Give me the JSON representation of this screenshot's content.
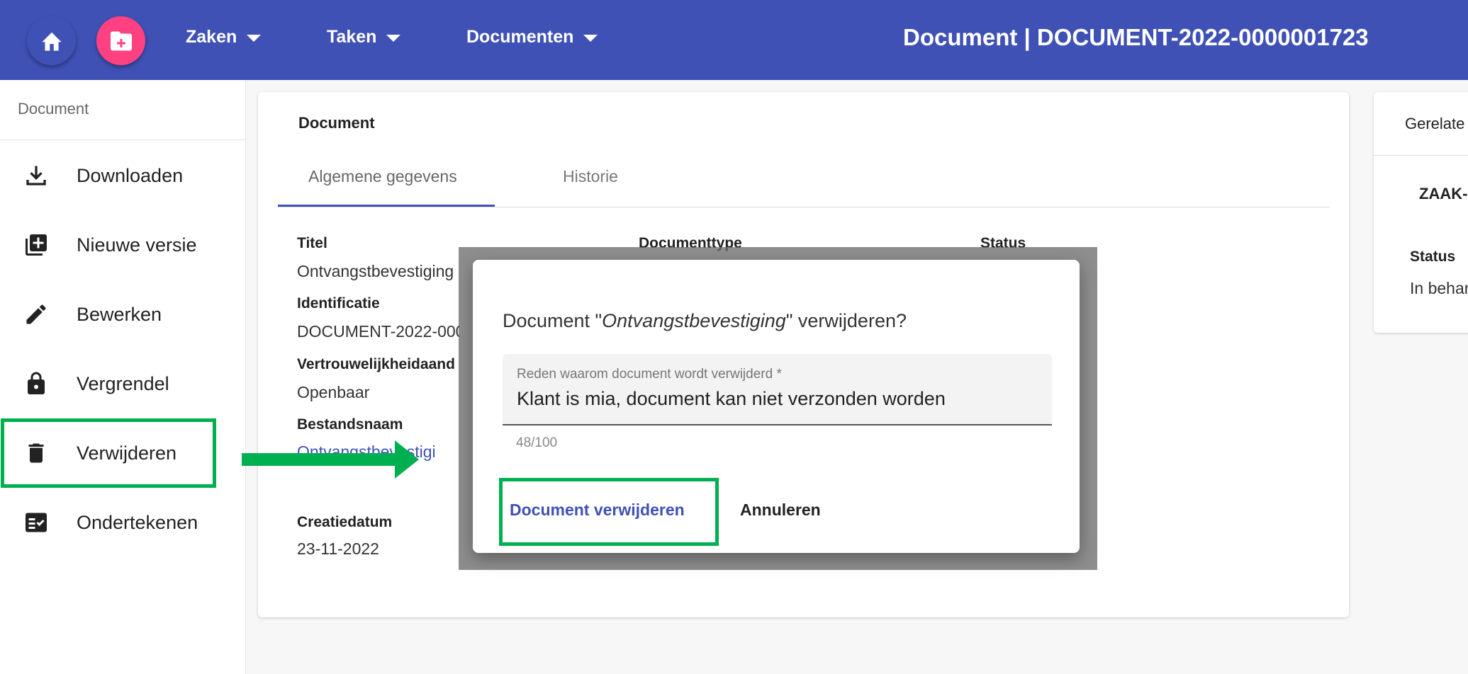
{
  "header": {
    "home_icon": "home-icon",
    "new_icon": "folder-plus-icon",
    "nav": [
      "Zaken",
      "Taken",
      "Documenten"
    ],
    "title": "Document | DOCUMENT-2022-0000001723",
    "colors": {
      "primary": "#3f51b5",
      "accent": "#ff4081"
    }
  },
  "sidebar": {
    "header": "Document",
    "items": [
      {
        "label": "Downloaden",
        "icon": "download-icon"
      },
      {
        "label": "Nieuwe versie",
        "icon": "new-version-icon"
      },
      {
        "label": "Bewerken",
        "icon": "pencil-icon"
      },
      {
        "label": "Vergrendel",
        "icon": "lock-icon"
      },
      {
        "label": "Verwijderen",
        "icon": "trash-icon"
      },
      {
        "label": "Ondertekenen",
        "icon": "sign-icon"
      }
    ]
  },
  "main": {
    "card_title": "Document",
    "tabs": [
      "Algemene gegevens",
      "Historie"
    ],
    "fields": {
      "titel_label": "Titel",
      "titel_value": "Ontvangstbevestiging",
      "identificatie_label": "Identificatie",
      "identificatie_value": "DOCUMENT-2022-000",
      "vertrouwelijkheid_label": "Vertrouwelijkheidaand",
      "vertrouwelijkheid_value": "Openbaar",
      "bestandsnaam_label": "Bestandsnaam",
      "bestandsnaam_value": "Ontvangstbevestigi",
      "documenttype_label": "Documenttype",
      "status_label": "Status",
      "creatiedatum_label": "Creatiedatum",
      "creatiedatum_value": "23-11-2022"
    }
  },
  "right_panel": {
    "header": "Gerelate",
    "zaak": "ZAAK-",
    "status_label": "Status",
    "status_value": "In behar"
  },
  "dialog": {
    "title_prefix": "Document \"",
    "title_doc": "Ontvangstbevestiging",
    "title_suffix": "\" verwijderen?",
    "input_label": "Reden waarom document wordt verwijderd *",
    "input_value": "Klant is mia, document kan niet verzonden worden",
    "counter": "48/100",
    "confirm_label": "Document verwijderen",
    "cancel_label": "Annuleren"
  },
  "annotations": {
    "highlight_color": "#00b050",
    "arrow_icon": "arrow-right-icon"
  }
}
